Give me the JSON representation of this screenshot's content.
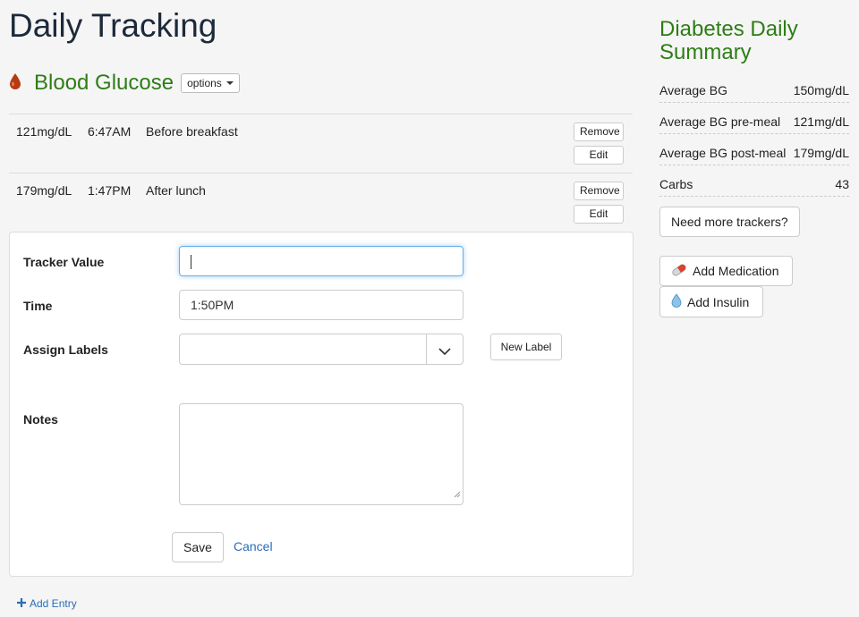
{
  "page": {
    "title": "Daily Tracking"
  },
  "section": {
    "title": "Blood Glucose",
    "options_label": "options",
    "icon": "blood-drop-icon",
    "accent": "#2e7d16"
  },
  "entries": [
    {
      "value": "121mg/dL",
      "time": "6:47AM",
      "note": "Before breakfast",
      "remove_label": "Remove",
      "edit_label": "Edit"
    },
    {
      "value": "179mg/dL",
      "time": "1:47PM",
      "note": "After lunch",
      "remove_label": "Remove",
      "edit_label": "Edit"
    }
  ],
  "form": {
    "tracker_value_label": "Tracker Value",
    "tracker_value": "",
    "time_label": "Time",
    "time_value": "1:50PM",
    "labels_label": "Assign Labels",
    "new_label_button": "New Label",
    "notes_label": "Notes",
    "save_label": "Save",
    "cancel_label": "Cancel"
  },
  "add_entry_label": "Add Entry",
  "summary": {
    "title": "Diabetes Daily Summary",
    "stats": [
      {
        "label": "Average BG",
        "value": "150mg/dL"
      },
      {
        "label": "Average BG pre-meal",
        "value": "121mg/dL"
      },
      {
        "label": "Average BG post-meal",
        "value": "179mg/dL"
      },
      {
        "label": "Carbs",
        "value": "43"
      }
    ],
    "more_trackers_label": "Need more trackers?",
    "add_medication_label": "Add Medication",
    "add_insulin_label": "Add Insulin"
  }
}
